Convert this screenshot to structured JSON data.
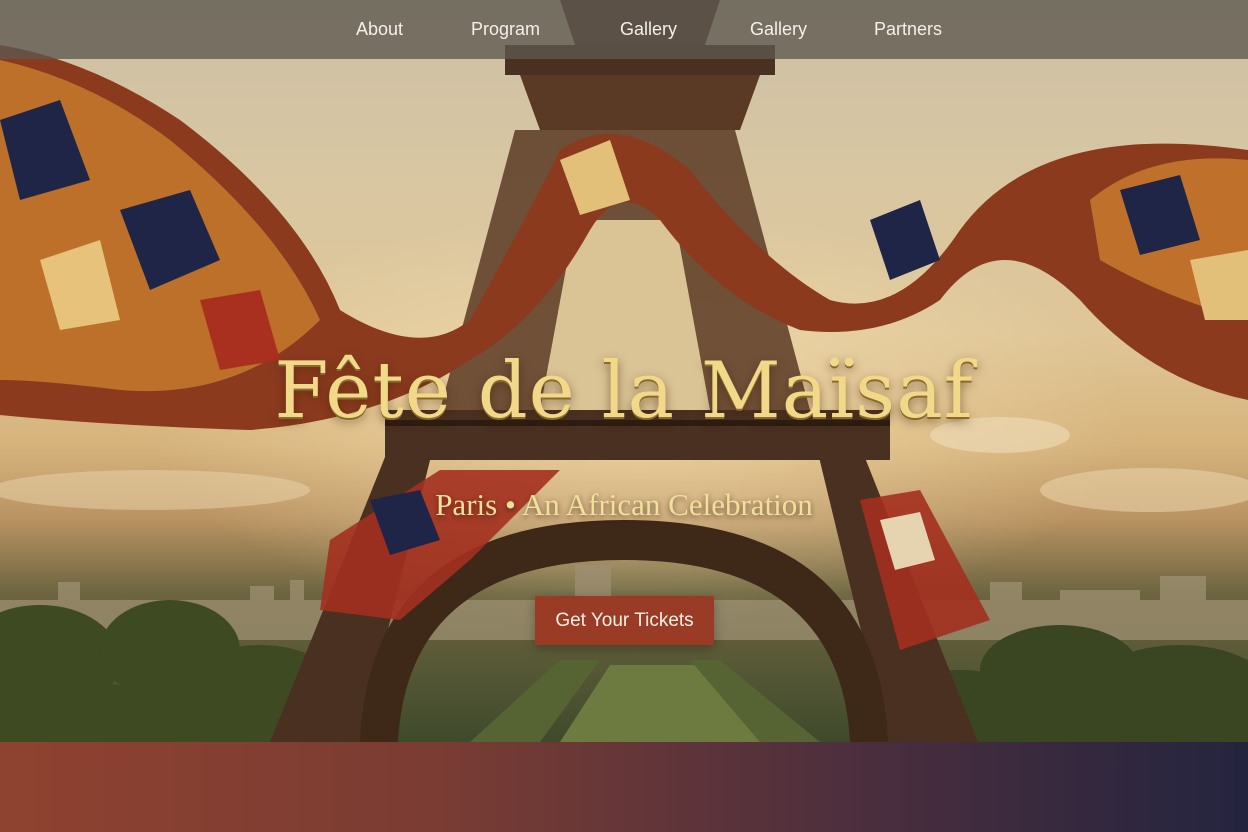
{
  "nav": {
    "items": [
      {
        "label": "About"
      },
      {
        "label": "Program"
      },
      {
        "label": "Gallery"
      },
      {
        "label": "Gallery"
      },
      {
        "label": "Partners"
      }
    ]
  },
  "hero": {
    "title": "Fête de la Maïsaf",
    "subtitle": "Paris • An African Celebration",
    "cta_label": "Get Your Tickets",
    "background_image": "Eiffel Tower at sunset wrapped in flowing African patchwork fabric, Paris skyline and park below"
  },
  "colors": {
    "nav_bg": "#5c5850",
    "title_gold": "#f2d98a",
    "cta_bg": "#9a3b26",
    "band_left": "#8f4230",
    "band_right": "#24243f"
  }
}
